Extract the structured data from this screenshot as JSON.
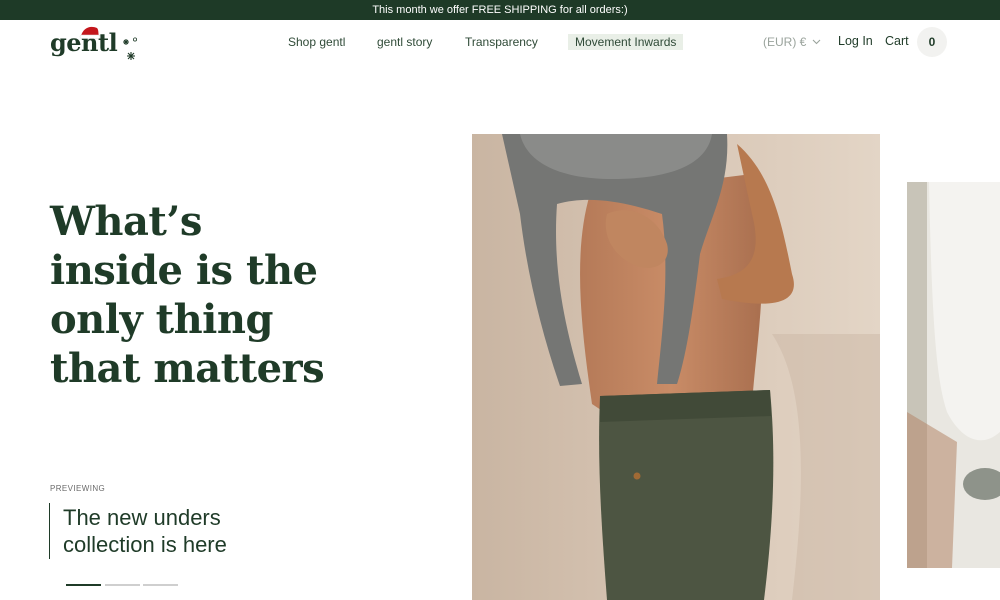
{
  "promo": {
    "text": "This month we offer FREE SHIPPING for all orders:)"
  },
  "brand": {
    "name": "gentl",
    "logo_icons": [
      "santa-hat-icon",
      "snowflake-icon"
    ]
  },
  "nav": {
    "items": [
      {
        "label": "Shop gentl"
      },
      {
        "label": "gentl story"
      },
      {
        "label": "Transparency"
      },
      {
        "label": "Movement Inwards",
        "active": true
      }
    ]
  },
  "header": {
    "currency": "(EUR) €",
    "login": "Log In",
    "cart": "Cart",
    "cart_count": "0"
  },
  "hero": {
    "title_lines": [
      "What’s",
      "inside is the",
      "only thing",
      "that matters"
    ],
    "preview_label": "PREVIEWING",
    "preview_lines": [
      "The new unders",
      "collection is here"
    ],
    "slides_total": 3,
    "active_slide": 1
  },
  "colors": {
    "brand_green": "#1e3a27",
    "text_green": "#1f3b28",
    "active_nav_bg": "#e9efe7",
    "hat_red": "#c4161c"
  }
}
